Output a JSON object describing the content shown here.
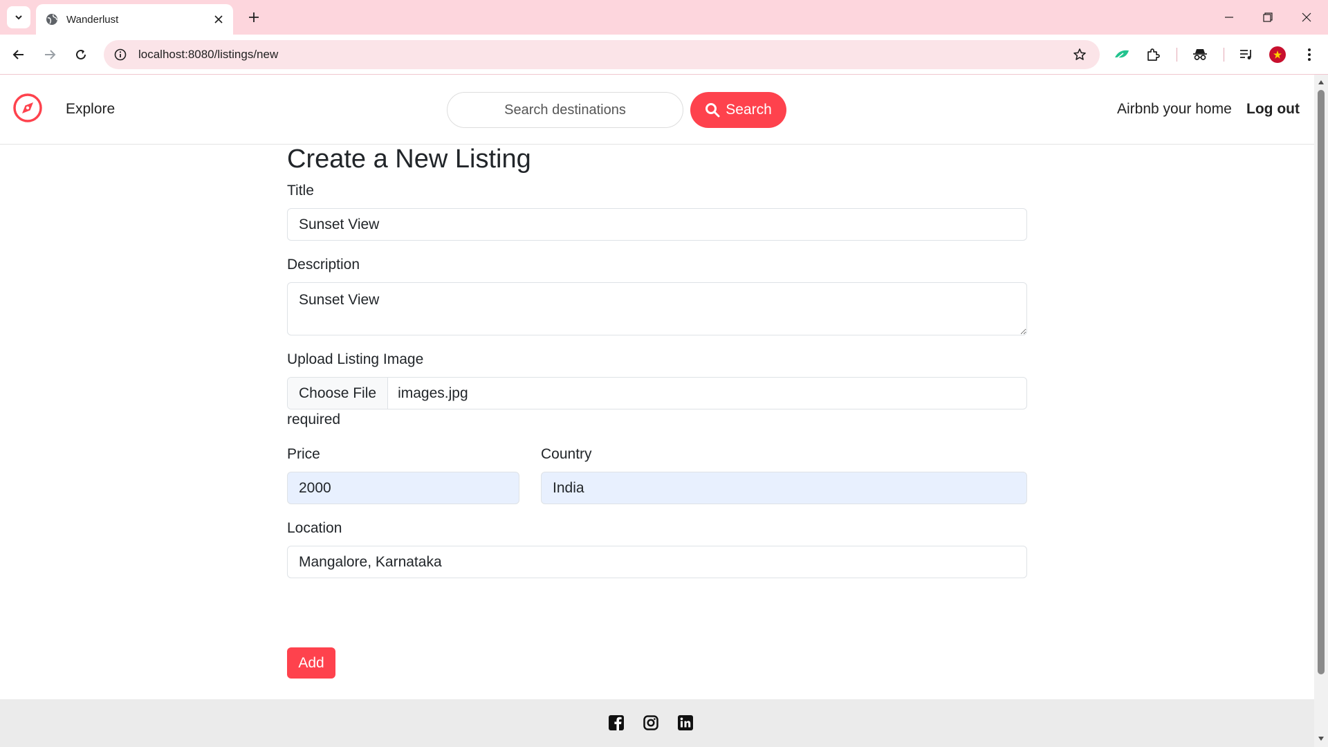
{
  "browser": {
    "tab_title": "Wanderlust",
    "url": "localhost:8080/listings/new"
  },
  "navbar": {
    "explore_label": "Explore",
    "search_placeholder": "Search destinations",
    "search_button_label": "Search",
    "host_link_label": "Airbnb your home",
    "logout_label": "Log out"
  },
  "form": {
    "heading": "Create a New Listing",
    "title_label": "Title",
    "title_value": "Sunset View",
    "description_label": "Description",
    "description_value": "Sunset View",
    "image_label": "Upload Listing Image",
    "file_button_label": "Choose File",
    "file_name": "images.jpg",
    "image_hint": "required",
    "price_label": "Price",
    "price_value": "2000",
    "country_label": "Country",
    "country_value": "India",
    "location_label": "Location",
    "location_value": "Mangalore, Karnataka",
    "submit_label": "Add"
  },
  "footer": {
    "icons": [
      "facebook-icon",
      "instagram-icon",
      "linkedin-icon"
    ]
  },
  "colors": {
    "brand": "#fe424d",
    "tabbar": "#fdd6dd",
    "autofill": "#e8f0fe"
  }
}
